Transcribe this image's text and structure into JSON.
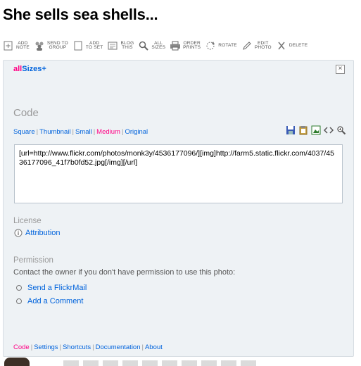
{
  "page": {
    "title": "She sells sea shells..."
  },
  "toolbar": [
    {
      "name": "add-note",
      "icon": "note-icon",
      "lines": [
        "ADD",
        "NOTE"
      ]
    },
    {
      "name": "send-to-group",
      "icon": "group-icon",
      "lines": [
        "SEND TO",
        "GROUP"
      ]
    },
    {
      "name": "add-to-set",
      "icon": "set-icon",
      "lines": [
        "ADD",
        "TO SET"
      ]
    },
    {
      "name": "blog-this",
      "icon": "blog-icon",
      "lines": [
        "BLOG",
        "THIS"
      ]
    },
    {
      "name": "all-sizes",
      "icon": "magnifier-icon",
      "lines": [
        "ALL",
        "SIZES"
      ]
    },
    {
      "name": "order-prints",
      "icon": "printer-icon",
      "lines": [
        "ORDER",
        "PRINTS"
      ]
    },
    {
      "name": "rotate",
      "icon": "rotate-icon",
      "lines": [
        "ROTATE"
      ]
    },
    {
      "name": "edit-photo",
      "icon": "pencil-icon",
      "lines": [
        "EDIT",
        "PHOTO"
      ]
    },
    {
      "name": "delete",
      "icon": "delete-icon",
      "lines": [
        "DELETE"
      ]
    }
  ],
  "panel": {
    "brand_all": "all",
    "brand_rest": "Sizes+",
    "close": "×",
    "code_heading": "Code",
    "sizes": [
      "Square",
      "Thumbnail",
      "Small",
      "Medium",
      "Original"
    ],
    "selected_size": "Medium",
    "code_text": "[url=http://www.flickr.com/photos/monk3y/4536177096/][img]http://farm5.static.flickr.com/4037/4536177096_41f7b0fd52.jpg[/img][/url]",
    "license_heading": "License",
    "license_link": "Attribution",
    "permission_heading": "Permission",
    "permission_text": "Contact the owner if you don't have permission to use this photo:",
    "permission_links": [
      "Send a FlickrMail",
      "Add a Comment"
    ],
    "footer": [
      "Code",
      "Settings",
      "Shortcuts",
      "Documentation",
      "About"
    ],
    "footer_selected": "Code"
  },
  "colors": {
    "link": "#0063dc",
    "accent": "#ff0084",
    "muted": "#999999",
    "panel_bg": "#eef2f5"
  }
}
